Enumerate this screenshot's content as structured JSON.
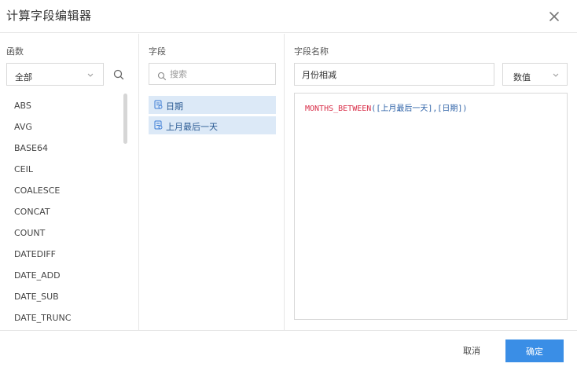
{
  "dialog": {
    "title": "计算字段编辑器",
    "close_icon": "close-icon"
  },
  "functions": {
    "label": "函数",
    "category_select": {
      "value": "全部"
    },
    "search_icon": "search-icon",
    "items": [
      "ABS",
      "AVG",
      "BASE64",
      "CEIL",
      "COALESCE",
      "CONCAT",
      "COUNT",
      "DATEDIFF",
      "DATE_ADD",
      "DATE_SUB",
      "DATE_TRUNC"
    ]
  },
  "fields": {
    "label": "字段",
    "search": {
      "placeholder": "搜索",
      "value": ""
    },
    "items": [
      {
        "label": "日期",
        "icon": "field-icon"
      },
      {
        "label": "上月最后一天",
        "icon": "field-icon"
      }
    ]
  },
  "field_name": {
    "label": "字段名称",
    "value": "月份相减",
    "type_select": {
      "value": "数值"
    }
  },
  "expression": {
    "function": "MONTHS_BETWEEN",
    "args": "([上月最后一天],[日期])"
  },
  "footer": {
    "cancel_label": "取消",
    "ok_label": "确定"
  },
  "colors": {
    "primary": "#3a8ee6",
    "function_name": "#d9304a",
    "field_reference": "#2f63a8",
    "selected_field_bg": "#dce9f7"
  }
}
